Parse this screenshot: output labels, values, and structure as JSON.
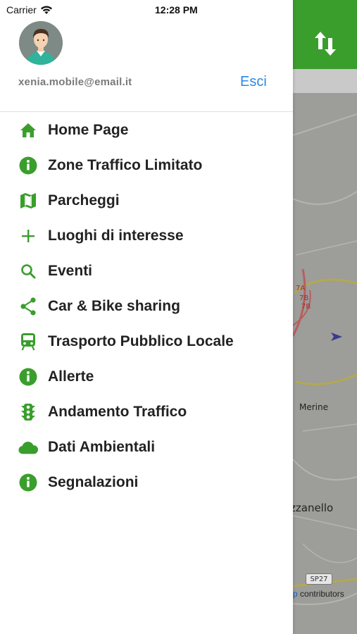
{
  "status_bar": {
    "carrier": "Carrier",
    "time": "12:28 PM"
  },
  "user": {
    "email": "xenia.mobile@email.it",
    "logout_label": "Esci"
  },
  "menu": {
    "items": [
      {
        "label": "Home Page",
        "icon": "home-icon"
      },
      {
        "label": "Zone Traffico Limitato",
        "icon": "info-icon"
      },
      {
        "label": "Parcheggi",
        "icon": "map-icon"
      },
      {
        "label": "Luoghi di interesse",
        "icon": "plus-icon"
      },
      {
        "label": "Eventi",
        "icon": "search-icon"
      },
      {
        "label": "Car & Bike sharing",
        "icon": "share-icon"
      },
      {
        "label": "Trasporto Pubblico Locale",
        "icon": "train-icon"
      },
      {
        "label": "Allerte",
        "icon": "info-icon"
      },
      {
        "label": "Andamento Traffico",
        "icon": "traffic-light-icon"
      },
      {
        "label": "Dati Ambientali",
        "icon": "cloud-icon"
      },
      {
        "label": "Segnalazioni",
        "icon": "info-icon"
      }
    ]
  },
  "map": {
    "town_label_1": "Merine",
    "town_label_2": "zzanello",
    "road_badge": "SP27",
    "road_marks": [
      "7A",
      "7B",
      "7B"
    ],
    "attribution_brand": "p",
    "attribution_text": " contributors"
  },
  "colors": {
    "accent_green": "#3a9e2c",
    "link_blue": "#2f86e6",
    "map_background": "#9d9d9a"
  }
}
